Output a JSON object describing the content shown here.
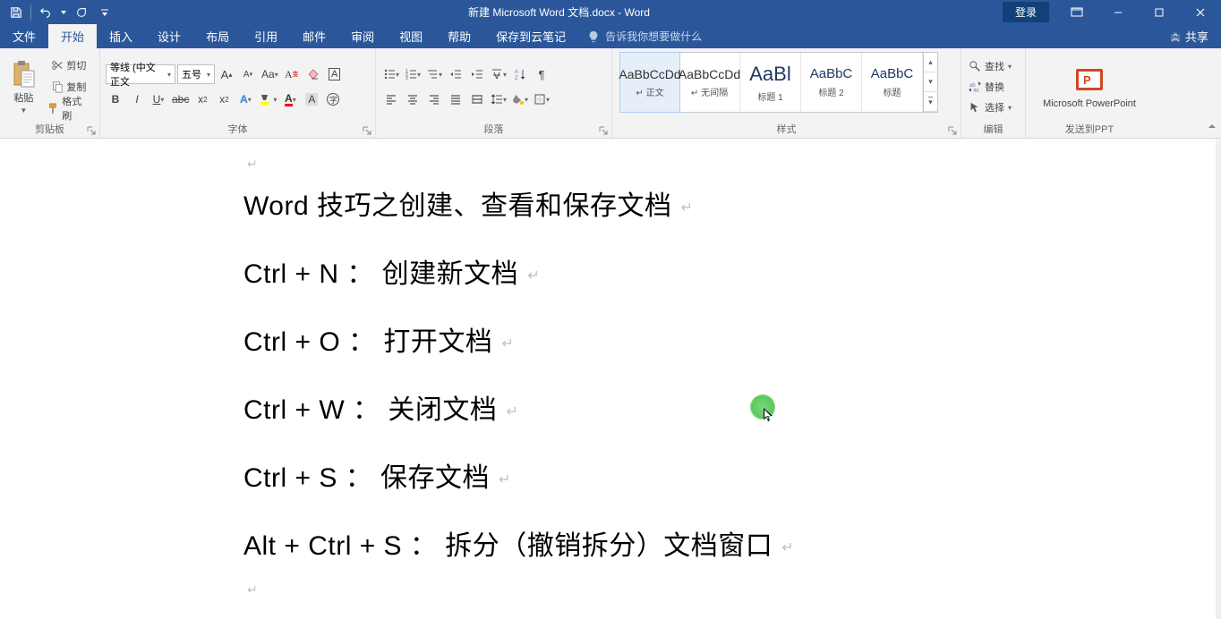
{
  "title": "新建 Microsoft Word 文档.docx - Word",
  "login": "登录",
  "tabs": {
    "file": "文件",
    "home": "开始",
    "insert": "插入",
    "design": "设计",
    "layout": "布局",
    "references": "引用",
    "mailings": "邮件",
    "review": "审阅",
    "view": "视图",
    "help": "帮助",
    "save_cloud": "保存到云笔记"
  },
  "tellme": "告诉我你想要做什么",
  "share": "共享",
  "groups": {
    "clipboard": "剪贴板",
    "font": "字体",
    "paragraph": "段落",
    "styles": "样式",
    "editing": "编辑",
    "ppt": "发送到PPT"
  },
  "clipboard": {
    "paste": "粘贴",
    "cut": "剪切",
    "copy": "复制",
    "format_painter": "格式刷"
  },
  "font": {
    "name": "等线 (中文正文",
    "size": "五号"
  },
  "styles": [
    {
      "preview": "AaBbCcDd",
      "name": "↵ 正文",
      "cls": ""
    },
    {
      "preview": "AaBbCcDd",
      "name": "↵ 无间隔",
      "cls": ""
    },
    {
      "preview": "AaBl",
      "name": "标题 1",
      "cls": "big"
    },
    {
      "preview": "AaBbC",
      "name": "标题 2",
      "cls": "h"
    },
    {
      "preview": "AaBbC",
      "name": "标题",
      "cls": "h"
    }
  ],
  "editing": {
    "find": "查找",
    "replace": "替换",
    "select": "选择"
  },
  "ppt_label": "Microsoft PowerPoint",
  "document": {
    "lines": [
      "Word 技巧之创建、查看和保存文档",
      "Ctrl + N ： 创建新文档",
      "Ctrl + O ： 打开文档",
      "Ctrl + W ： 关闭文档",
      "Ctrl + S ： 保存文档",
      "Alt + Ctrl + S ： 拆分（撤销拆分）文档窗口"
    ]
  }
}
